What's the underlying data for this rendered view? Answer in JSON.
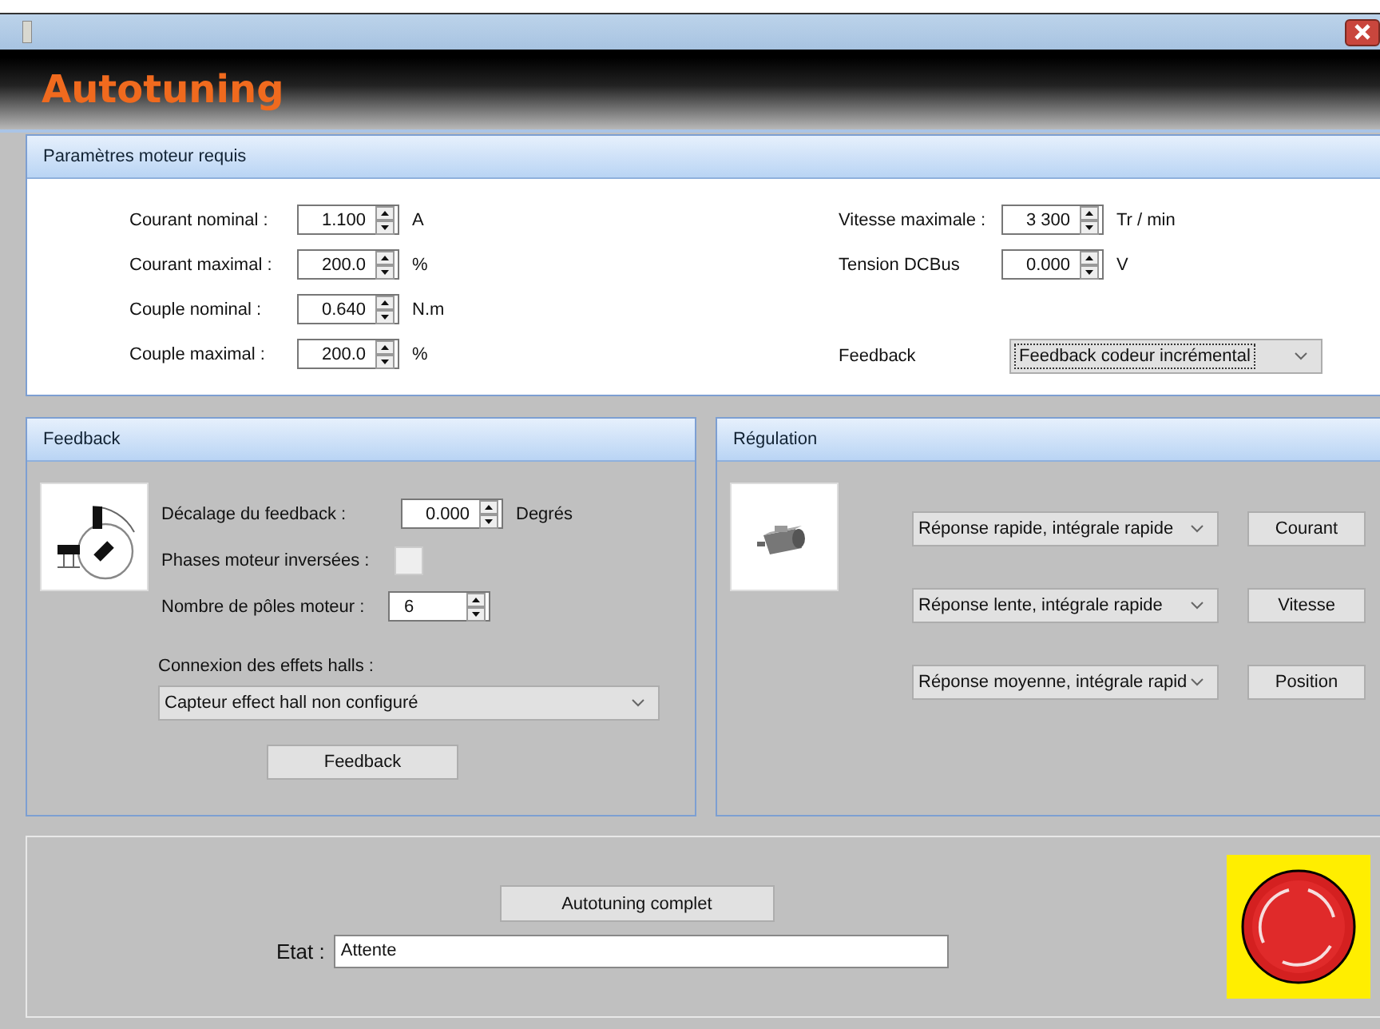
{
  "header": {
    "title": "Autotuning"
  },
  "motor_params": {
    "title": "Paramètres moteur requis",
    "left_fields": [
      {
        "label": "Courant nominal :",
        "value": "1.100",
        "unit": "A"
      },
      {
        "label": "Courant maximal :",
        "value": "200.0",
        "unit": "%"
      },
      {
        "label": "Couple nominal :",
        "value": "0.640",
        "unit": "N.m"
      },
      {
        "label": "Couple maximal :",
        "value": "200.0",
        "unit": "%"
      }
    ],
    "right_fields": [
      {
        "label": "Vitesse maximale :",
        "value": "3 300",
        "unit": "Tr / min"
      },
      {
        "label": "Tension DCBus",
        "value": "0.000",
        "unit": "V"
      }
    ],
    "feedback": {
      "label": "Feedback",
      "value": "Feedback codeur incrémental"
    }
  },
  "feedback_panel": {
    "title": "Feedback",
    "offset": {
      "label": "Décalage du feedback :",
      "value": "0.000",
      "unit": "Degrés"
    },
    "phases": {
      "label": "Phases moteur inversées :",
      "checked": false
    },
    "poles": {
      "label": "Nombre de pôles moteur :",
      "value": "6"
    },
    "hall_label": "Connexion des effets halls :",
    "hall_select": "Capteur effect hall non configuré",
    "button": "Feedback"
  },
  "regulation": {
    "title": "Régulation",
    "rows": [
      {
        "select": "Réponse rapide, intégrale rapide",
        "button": "Courant"
      },
      {
        "select": "Réponse lente, intégrale rapide",
        "button": "Vitesse"
      },
      {
        "select": "Réponse moyenne, intégrale rapid",
        "button": "Position"
      }
    ]
  },
  "bottom": {
    "button": "Autotuning complet",
    "state_label": "Etat :",
    "state_value": "Attente"
  }
}
